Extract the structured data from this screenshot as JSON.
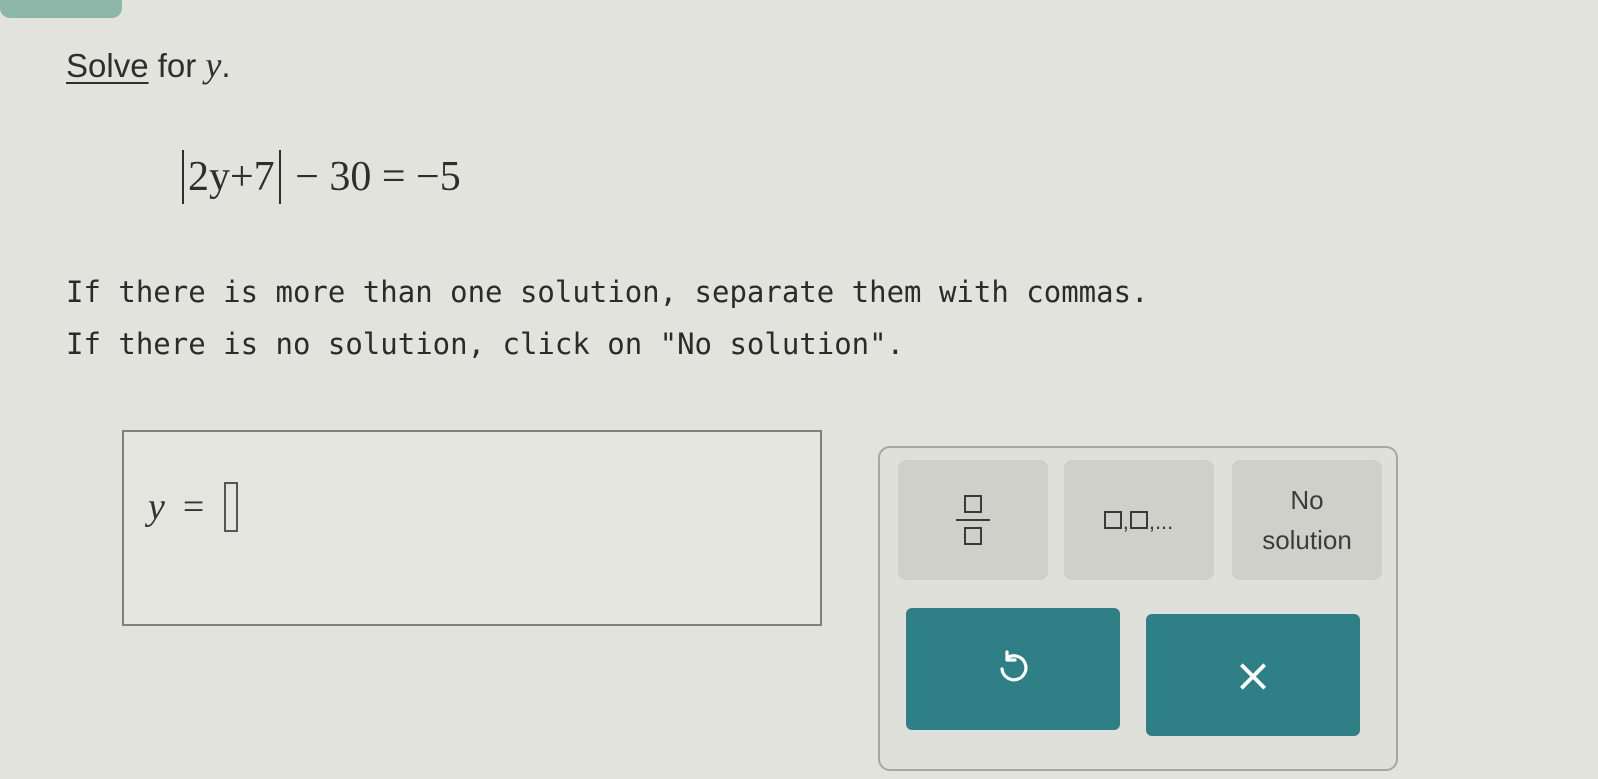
{
  "question": {
    "solve_link": "Solve",
    "title_middle": " for ",
    "variable": "y",
    "title_end": ".",
    "equation_inner": "2y+7",
    "equation_rest": " − 30 = −5",
    "instruction_line1": "If there is more than one solution, separate them with commas.",
    "instruction_line2": "If there is no solution, click on \"No solution\"."
  },
  "answer": {
    "variable": "y",
    "equals": "=",
    "value": ""
  },
  "keypad": {
    "list_suffix": ",...",
    "no_solution_line1": "No",
    "no_solution_line2": "solution",
    "clear_symbol": "×"
  },
  "colors": {
    "background": "#e2e3dc",
    "action_button": "#2f7f86",
    "key": "#cfd0c9",
    "tab": "#8db7a8"
  },
  "icons": {
    "fraction_key": "fraction-template-icon",
    "list_key": "comma-list-template-icon",
    "undo": "undo-icon",
    "clear": "close-icon"
  }
}
